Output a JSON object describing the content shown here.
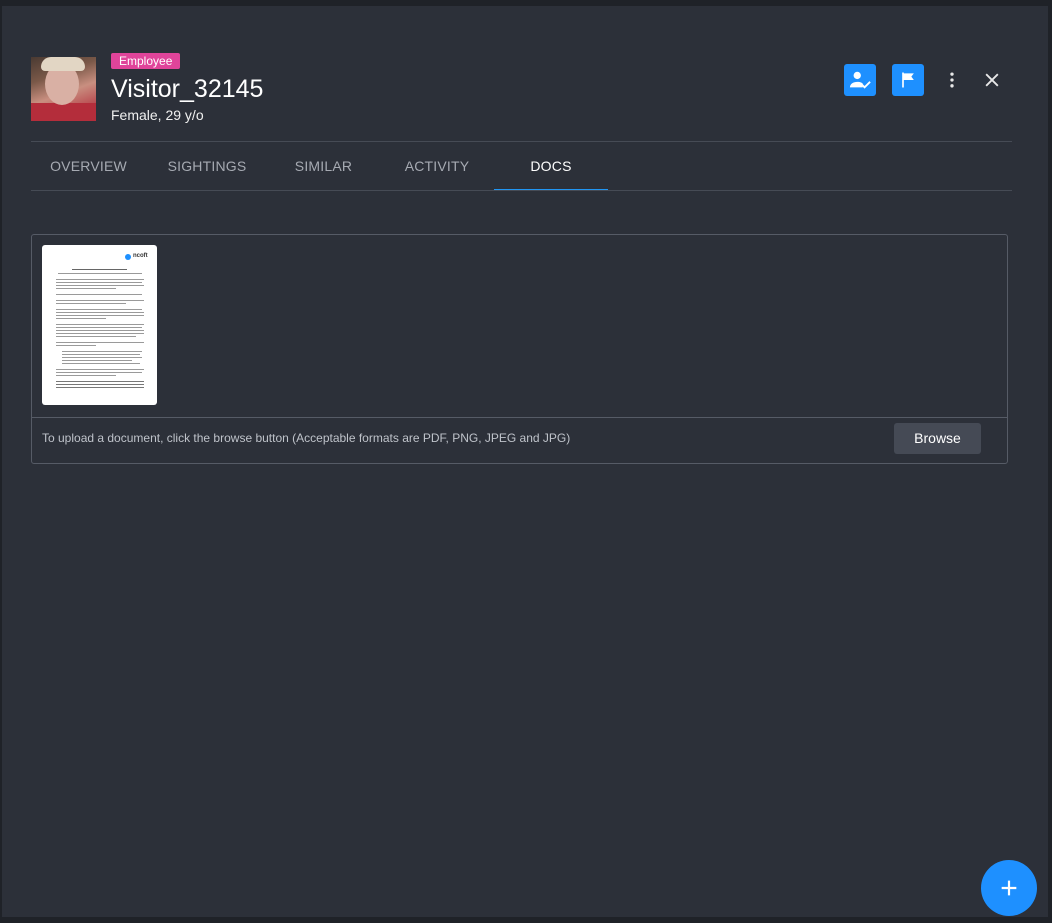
{
  "header": {
    "badge": "Employee",
    "title": "Visitor_32145",
    "subtitle": "Female, 29 y/o",
    "actions": [
      {
        "icon": "person-check-icon"
      },
      {
        "icon": "flag-icon"
      },
      {
        "icon": "more-vertical-icon"
      },
      {
        "icon": "close-icon"
      }
    ]
  },
  "tabs": [
    {
      "label": "OVERVIEW"
    },
    {
      "label": "SIGHTINGS"
    },
    {
      "label": "SIMILAR"
    },
    {
      "label": "ACTIVITY"
    },
    {
      "label": "DOCS"
    }
  ],
  "active_tab": "DOCS",
  "docs": {
    "thumbnail_logo": "ncoft",
    "upload_instructions": "To upload a document, click the browse button (Acceptable formats are PDF, PNG, JPEG and JPG)",
    "browse_label": "Browse"
  },
  "fab": {
    "icon": "plus-icon"
  },
  "colors": {
    "accent": "#1e90ff",
    "badge": "#e0449a",
    "panel": "#2c3039",
    "background": "#1f2228"
  }
}
